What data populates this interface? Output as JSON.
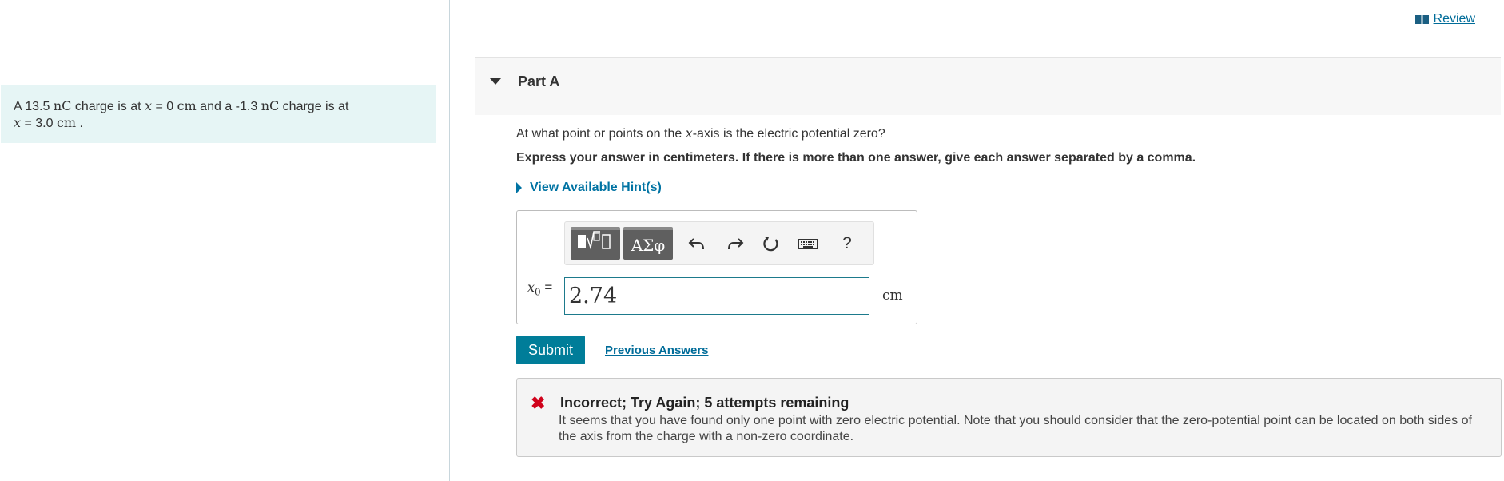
{
  "review": {
    "label": "Review"
  },
  "problem": {
    "t1": "A 13.5 ",
    "unit_nC": "nC",
    "t2": " charge is at ",
    "var_x": "x",
    "t3": " = 0 ",
    "unit_cm": "cm",
    "t4": " and a -1.3 ",
    "unit_nC2": "nC",
    "t5": " charge is at",
    "var_x2": "x",
    "t6": " = 3.0 ",
    "unit_cm2": "cm",
    "t7": " ."
  },
  "part": {
    "title": "Part A"
  },
  "question": {
    "before": "At what point or points on the ",
    "var": "x",
    "after": "-axis is the electric potential zero?"
  },
  "instruction": "Express your answer in centimeters. If there is more than one answer, give each answer separated by a comma.",
  "hints": {
    "label": "View Available Hint(s)"
  },
  "toolbar": {
    "greek_label": "ΑΣφ",
    "help_label": "?"
  },
  "answer": {
    "var": "x",
    "subscript": "0",
    "equals": " =",
    "value": "2.74",
    "unit": "cm"
  },
  "actions": {
    "submit_label": "Submit",
    "previous_answers_label": "Previous Answers"
  },
  "feedback": {
    "title": "Incorrect; Try Again; 5 attempts remaining",
    "body": "It seems that you have found only one point with zero electric potential. Note that you should consider that the zero-potential point can be located on both sides of the axis from the charge with a non-zero coordinate.",
    "error_color": "#d0021b"
  },
  "colors": {
    "accent": "#007d99",
    "link": "#006c99",
    "problem_bg": "#e6f5f5"
  }
}
